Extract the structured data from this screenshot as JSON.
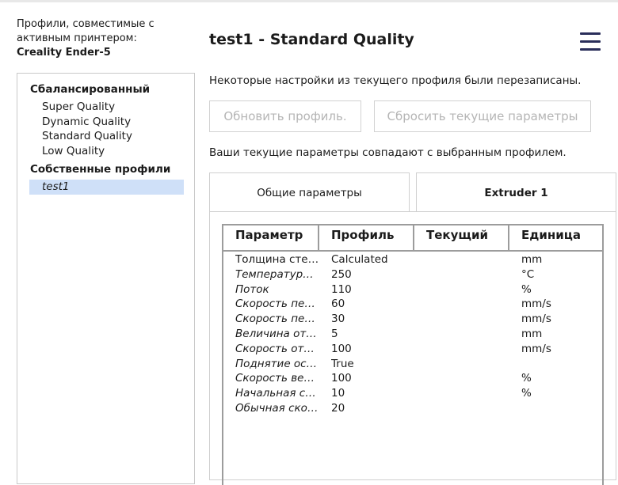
{
  "compat": {
    "line1": "Профили, совместимые с",
    "line2": "активным принтером:",
    "printer": "Creality Ender-5"
  },
  "profiles": {
    "group_builtin": "Сбалансированный",
    "builtin": [
      "Super Quality",
      "Dynamic Quality",
      "Standard Quality",
      "Low Quality"
    ],
    "group_custom": "Собственные профили",
    "custom": [
      "test1"
    ]
  },
  "header": {
    "title": "test1 - Standard Quality",
    "menu_icon": "hamburger-menu-icon"
  },
  "notices": {
    "overwritten": "Некоторые настройки из текущего профиля были перезаписаны.",
    "match": "Ваши текущие параметры совпадают с выбранным профилем."
  },
  "buttons": {
    "update": "Обновить профиль.",
    "discard": "Сбросить текущие параметры"
  },
  "tabs": [
    "Общие параметры",
    "Extruder 1"
  ],
  "table": {
    "headers": [
      "Параметр",
      "Профиль",
      "Текущий",
      "Единица"
    ],
    "rows": [
      {
        "name": "Толщина стенки",
        "profile": "Calculated",
        "current": "",
        "unit": "mm",
        "italic": false
      },
      {
        "name": "Температура сопла",
        "profile": "250",
        "current": "",
        "unit": "°C",
        "italic": true
      },
      {
        "name": "Поток",
        "profile": "110",
        "current": "",
        "unit": "%",
        "italic": true
      },
      {
        "name": "Скорость печати",
        "profile": "60",
        "current": "",
        "unit": "mm/s",
        "italic": true
      },
      {
        "name": "Скорость перемещения",
        "profile": "30",
        "current": "",
        "unit": "mm/s",
        "italic": true
      },
      {
        "name": "Величина отката",
        "profile": "5",
        "current": "",
        "unit": "mm",
        "italic": true
      },
      {
        "name": "Скорость отката",
        "profile": "100",
        "current": "",
        "unit": "mm/s",
        "italic": true
      },
      {
        "name": "Поднятие оси Z при откате",
        "profile": "True",
        "current": "",
        "unit": "",
        "italic": true
      },
      {
        "name": "Скорость вентилятора",
        "profile": "100",
        "current": "",
        "unit": "%",
        "italic": true
      },
      {
        "name": "Начальная скорость вентилятора",
        "profile": "10",
        "current": "",
        "unit": "%",
        "italic": true
      },
      {
        "name": "Обычная скорость вентилятора",
        "profile": "20",
        "current": "",
        "unit": "",
        "italic": true
      }
    ]
  },
  "colors": {
    "selection": "#cfe0f8",
    "menu_icon": "#2a2e5a",
    "disabled_text": "#b5b5b5"
  }
}
